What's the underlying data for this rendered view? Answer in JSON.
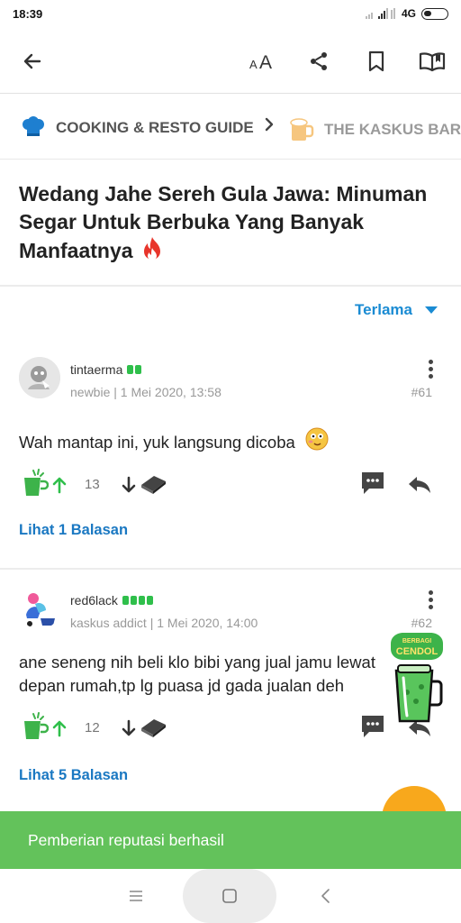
{
  "status_bar": {
    "time": "18:39",
    "network": "4G"
  },
  "app_bar": {
    "back_icon": "arrow-left-icon",
    "font_size_icon": "text-size-icon",
    "share_icon": "share-icon",
    "bookmark_icon": "bookmark-icon",
    "read_icon": "book-icon"
  },
  "breadcrumb": {
    "items": [
      {
        "label": "COOKING & RESTO GUIDE",
        "icon": "chef-hat-icon"
      },
      {
        "label": "THE KASKUS BAR",
        "icon": "beer-mug-icon"
      }
    ],
    "separator_icon": "chevron-right-icon"
  },
  "thread": {
    "title": "Wedang Jahe Sereh Gula Jawa: Minuman Segar Untuk Berbuka Yang Banyak Manfaatnya",
    "hot_icon": "fire-icon"
  },
  "sort": {
    "label": "Terlama",
    "icon": "caret-down-icon"
  },
  "posts": [
    {
      "username": "tintaerma",
      "meta": "newbie | 1 Mei 2020, 13:58",
      "number": "#61",
      "body": "Wah mantap ini, yuk langsung dicoba",
      "emoji": "smiley-emoji-icon",
      "reputation_level": 2,
      "votes": "13",
      "replies_link": "Lihat 1 Balasan"
    },
    {
      "username": "red6lack",
      "meta": "kaskus addict | 1 Mei 2020, 14:00",
      "number": "#62",
      "body": "ane seneng nih beli klo bibi yang jual jamu lewat depan rumah,tp lg puasa jd gada jualan deh",
      "reputation_level": 4,
      "votes": "12",
      "replies_link": "Lihat 5 Balasan"
    }
  ],
  "cendol_badge": {
    "text": "BERBAGI CENDOL"
  },
  "toast": {
    "message": "Pemberian reputasi berhasil"
  },
  "colors": {
    "accent_blue": "#1a8bd3",
    "link_blue": "#1a78c2",
    "toast_green": "#63c25b",
    "reputation_green": "#2fbf4b",
    "fab_orange": "#f8a81c"
  }
}
